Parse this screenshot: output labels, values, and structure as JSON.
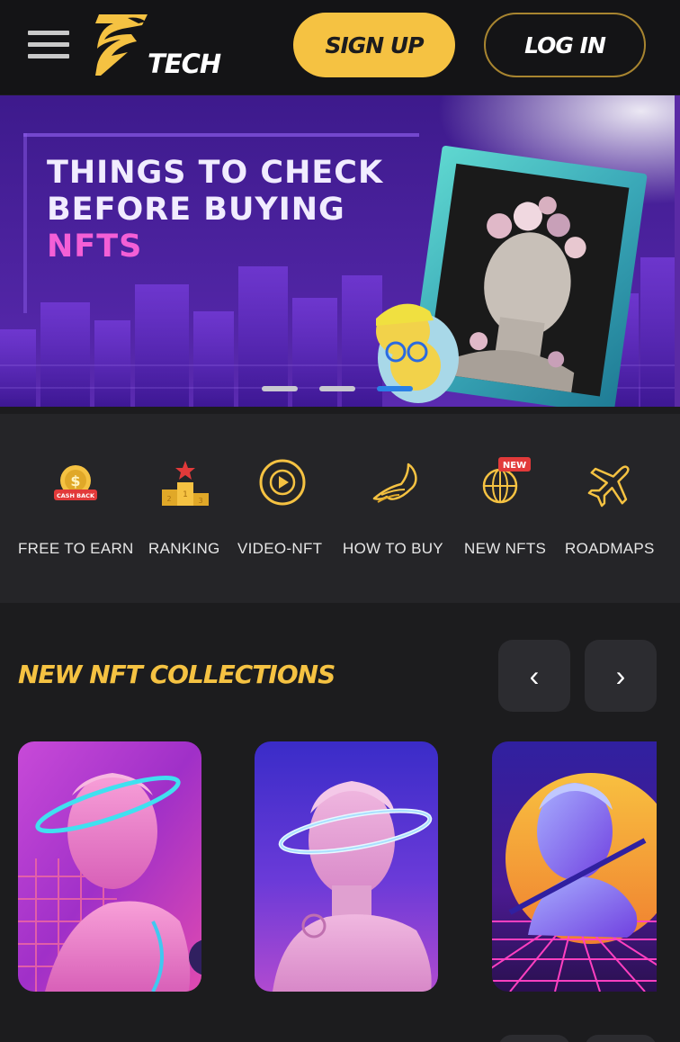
{
  "header": {
    "logo_text": "TECH",
    "signup_label": "SIGN UP",
    "login_label": "LOG IN"
  },
  "banner": {
    "line1": "THINGS TO CHECK",
    "line2": "BEFORE BUYING",
    "line3": "NFTS",
    "slide_count": 3,
    "active_slide": 3
  },
  "categories": [
    {
      "label": "FREE TO EARN",
      "icon": "cashback-coin-icon",
      "badge": "CASH BACK"
    },
    {
      "label": "RANKING",
      "icon": "podium-icon",
      "badge": ""
    },
    {
      "label": "VIDEO-NFT",
      "icon": "play-circle-icon",
      "badge": ""
    },
    {
      "label": "HOW TO BUY",
      "icon": "horse-icon",
      "badge": ""
    },
    {
      "label": "NEW NFTS",
      "icon": "globe-new-icon",
      "badge": "NEW"
    },
    {
      "label": "ROADMAPS",
      "icon": "airplane-icon",
      "badge": ""
    }
  ],
  "collections": {
    "title": "NEW NFT COLLECTIONS",
    "prev_label": "‹",
    "next_label": "›",
    "cards": [
      {
        "image": "pink-bust-halo-grid"
      },
      {
        "image": "pink-bust-halo-purple"
      },
      {
        "image": "blue-bust-sunset-grid"
      }
    ]
  },
  "colors": {
    "accent": "#f5c242",
    "background": "#1c1c1e",
    "header_bg": "#141416",
    "category_bg": "#252528",
    "active_dot": "#2a80e6",
    "banner_pink": "#f45fd6"
  }
}
